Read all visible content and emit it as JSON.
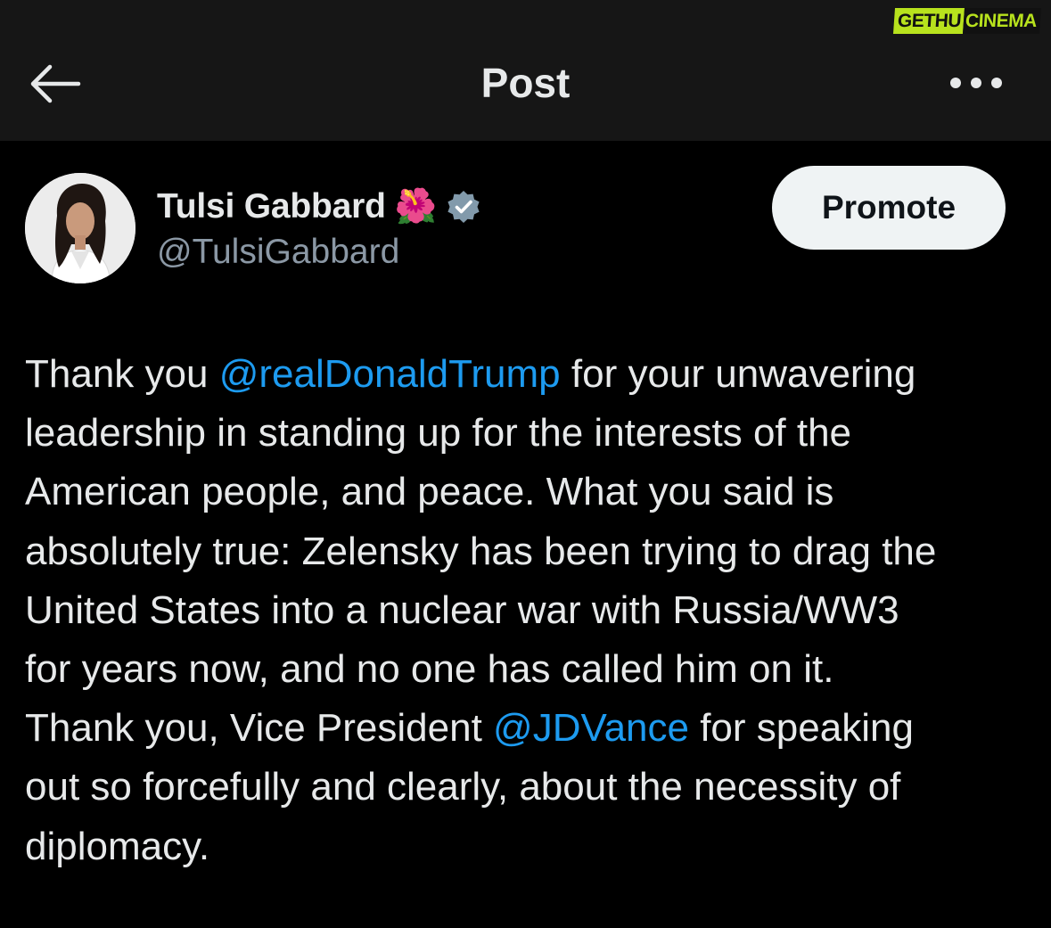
{
  "header": {
    "title": "Post",
    "back_icon": "arrow-left-icon",
    "more_icon": "more-horizontal-icon"
  },
  "watermark": {
    "part1": "GETHU",
    "part2": "CINEMA",
    "color": "#b8e21d"
  },
  "author": {
    "name": "Tulsi Gabbard",
    "emoji": "🌺",
    "verified_icon": "verified-badge-icon",
    "verified_color": "#829aab",
    "handle": "@TulsiGabbard"
  },
  "promote_button": {
    "label": "Promote"
  },
  "post": {
    "lines": [
      {
        "before": "Thank you ",
        "mention": "@realDonaldTrump",
        "after": " for your unwavering"
      },
      {
        "text": "leadership in standing up for the interests of the"
      },
      {
        "text": "American people, and peace. What you said is"
      },
      {
        "text": "absolutely true: Zelensky has been trying to drag the"
      },
      {
        "text": "United States into a nuclear war with Russia/WW3"
      },
      {
        "text": "for years now, and no one has called him on it."
      },
      {
        "before": "Thank you, Vice President ",
        "mention": "@JDVance",
        "after": " for speaking"
      },
      {
        "text": "out so forcefully and clearly, about the necessity of"
      },
      {
        "text": "diplomacy."
      }
    ]
  },
  "colors": {
    "background": "#000000",
    "header_background": "#161616",
    "text": "#e7e9ea",
    "secondary_text": "#8b98a5",
    "link": "#1d9bf0"
  }
}
